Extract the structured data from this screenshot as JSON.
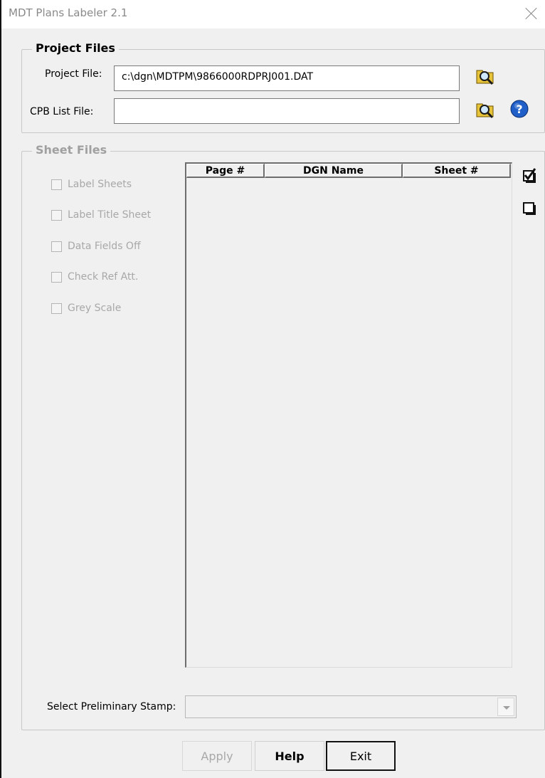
{
  "window": {
    "title": "MDT Plans Labeler 2.1"
  },
  "project_files": {
    "legend": "Project Files",
    "project_file_label": "Project File:",
    "project_file_value": "c:\\dgn\\MDTPM\\9866000RDPRJ001.DAT",
    "cpb_list_label": "CPB List File:",
    "cpb_list_value": ""
  },
  "sheet_files": {
    "legend": "Sheet Files",
    "options": [
      {
        "label": "Label Sheets",
        "checked": false
      },
      {
        "label": "Label Title Sheet",
        "checked": false
      },
      {
        "label": "Data Fields Off",
        "checked": false
      },
      {
        "label": "Check Ref Att.",
        "checked": false
      },
      {
        "label": "Grey Scale",
        "checked": false
      }
    ],
    "columns": [
      "Page #",
      "DGN Name",
      "Sheet #"
    ],
    "rows": []
  },
  "stamp": {
    "label": "Select Preliminary Stamp:",
    "value": ""
  },
  "buttons": {
    "apply": "Apply",
    "help": "Help",
    "exit": "Exit"
  },
  "icons": {
    "browse": "folder-search-icon",
    "help": "help-question-icon",
    "check_all": "check-all-icon",
    "uncheck_all": "uncheck-all-icon"
  },
  "colors": {
    "help_blue": "#1f5fc7",
    "folder_yellow": "#e7c33a"
  }
}
